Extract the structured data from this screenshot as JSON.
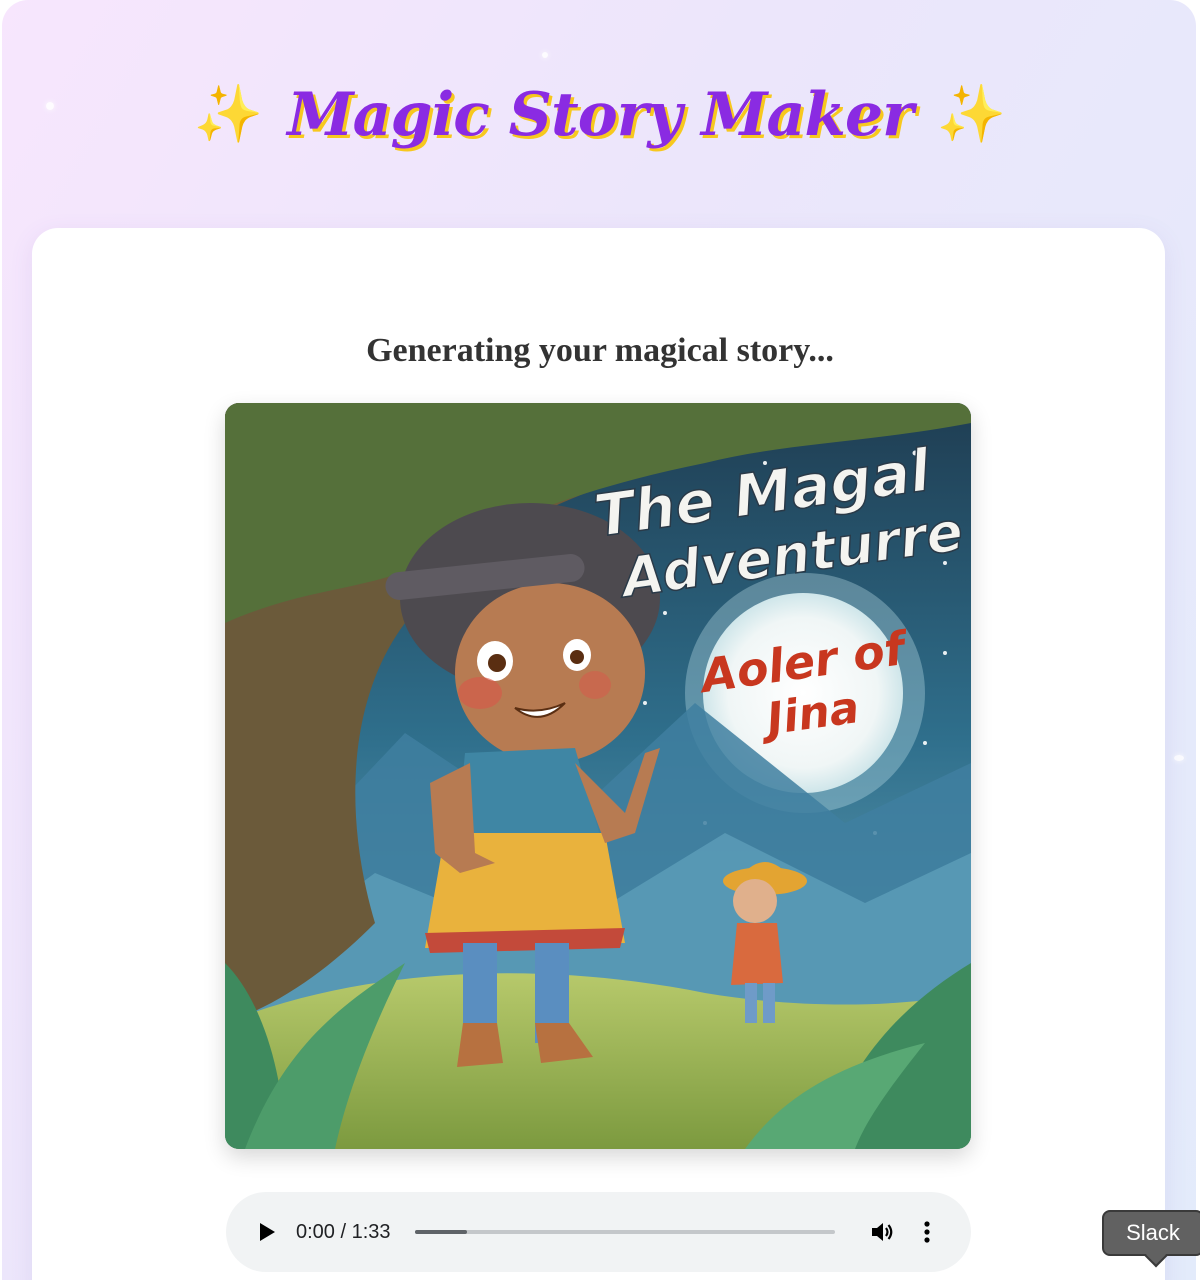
{
  "header": {
    "title": "Magic Story Maker",
    "star_left": "✨",
    "star_right": "✨"
  },
  "main": {
    "status": "Generating your magical story...",
    "cover": {
      "title_line1": "The Magal",
      "title_line2": "Adventurre",
      "subtitle_line1": "Aoler of",
      "subtitle_line2": "Jina"
    }
  },
  "audio": {
    "time": "0:00 / 1:33",
    "progress": 0,
    "buffered": 0.125
  },
  "tooltip": {
    "label": "Slack"
  },
  "colors": {
    "title": "#8a2be2",
    "title_shadow": "#f7c81e",
    "card": "#ffffff",
    "audio_bg": "#f1f3f4"
  }
}
